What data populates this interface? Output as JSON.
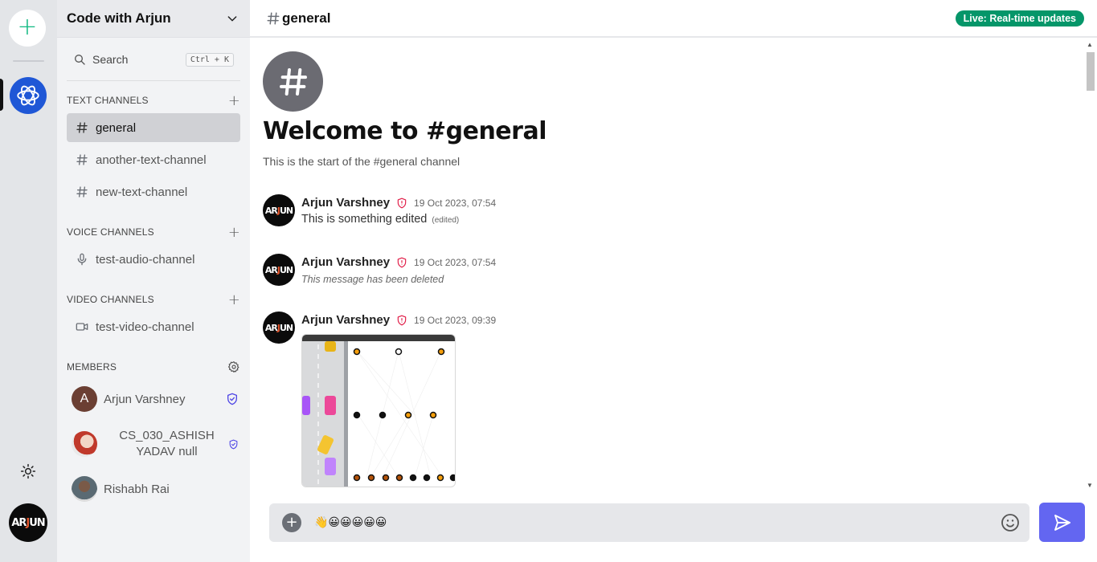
{
  "rail": {
    "add_label": "+",
    "avatar_logo_main": "AR",
    "avatar_logo_accent": "J",
    "avatar_logo_tail": "UN"
  },
  "sidebar": {
    "server_name": "Code with Arjun",
    "search_label": "Search",
    "search_shortcut": "Ctrl + K",
    "text_channels_label": "TEXT CHANNELS",
    "voice_channels_label": "VOICE CHANNELS",
    "video_channels_label": "VIDEO CHANNELS",
    "members_label": "MEMBERS",
    "text_channels": [
      {
        "name": "general",
        "active": true
      },
      {
        "name": "another-text-channel",
        "active": false
      },
      {
        "name": "new-text-channel",
        "active": false
      }
    ],
    "voice_channels": [
      {
        "name": "test-audio-channel"
      }
    ],
    "video_channels": [
      {
        "name": "test-video-channel"
      }
    ],
    "members": [
      {
        "name": "Arjun Varshney",
        "initial": "A"
      },
      {
        "name": "CS_030_ASHISH YADAV null"
      },
      {
        "name": "Rishabh Rai"
      }
    ]
  },
  "main": {
    "channel_title": "general",
    "live_badge": "Live: Real-time updates",
    "welcome_title": "Welcome to #general",
    "welcome_sub": "This is the start of the #general channel",
    "messages": [
      {
        "author": "Arjun Varshney",
        "time": "19 Oct 2023, 07:54",
        "text": "This is something edited",
        "edited": "(edited)"
      },
      {
        "author": "Arjun Varshney",
        "time": "19 Oct 2023, 07:54",
        "text": "This message has been deleted"
      },
      {
        "author": "Arjun Varshney",
        "time": "19 Oct 2023, 09:39",
        "attachment": "image"
      }
    ],
    "composer_value": "👋😀😀😀😀😀"
  },
  "colors": {
    "accent": "#6366f1",
    "live": "#059669",
    "add_green": "#10b981",
    "server_blue": "#1f57d6",
    "moderator_red": "#e11d48",
    "admin_blue": "#4f46e5"
  }
}
